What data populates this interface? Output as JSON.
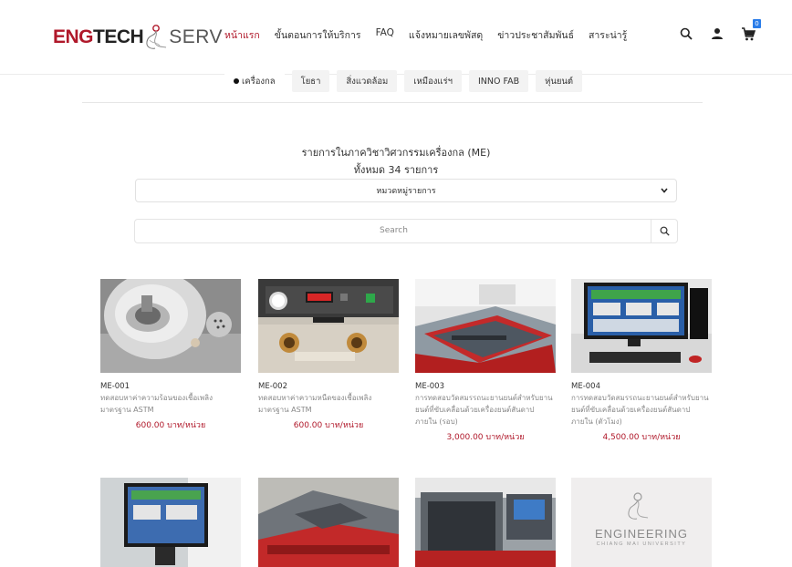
{
  "brand": {
    "part1": "ENG",
    "part2": "TECH",
    "part3": "SERV",
    "red": "#b0182a"
  },
  "nav": {
    "items": [
      "หน้าแรก",
      "ขั้นตอนการให้บริการ",
      "FAQ",
      "แจ้งหมายเลขพัสดุ",
      "ข่าวประชาสัมพันธ์",
      "สาระน่ารู้"
    ]
  },
  "header_icons": {
    "search": "search-icon",
    "user": "user-icon",
    "cart": "cart-icon",
    "cart_count": "0"
  },
  "tabs": [
    "เครื่องกล",
    "โยธา",
    "สิ่งแวดล้อม",
    "เหมืองแร่ฯ",
    "INNO FAB",
    "หุ่นยนต์"
  ],
  "heading": {
    "line1": "รายการในภาควิชาวิศวกรรมเครื่องกล (ME)",
    "line2": "ทั้งหมด 34 รายการ"
  },
  "category_select": {
    "value": "หมวดหมู่รายการ"
  },
  "search": {
    "placeholder": "Search"
  },
  "products": [
    {
      "code": "ME-001",
      "desc": "ทดสอบหาค่าความร้อนของเชื้อเพลิงมาตรฐาน ASTM",
      "price": "600.00 บาท/หน่วย"
    },
    {
      "code": "ME-002",
      "desc": "ทดสอบหาค่าความหนืดของเชื้อเพลิงมาตรฐาน ASTM",
      "price": "600.00 บาท/หน่วย"
    },
    {
      "code": "ME-003",
      "desc": "การทดสอบวัดสมรรถนะยานยนต์สำหรับยานยนต์ที่ขับเคลื่อนด้วยเครื่องยนต์สันดาปภายใน (รอบ)",
      "price": "3,000.00 บาท/หน่วย"
    },
    {
      "code": "ME-004",
      "desc": "การทดสอบวัดสมรรถนะยานยนต์สำหรับยานยนต์ที่ขับเคลื่อนด้วยเครื่องยนต์สันดาปภายใน (ตัวโมง)",
      "price": "4,500.00 บาท/หน่วย"
    }
  ],
  "placeholder_logo": {
    "line1": "ENGINEERING",
    "line2": "CHIANG MAI UNIVERSITY"
  }
}
